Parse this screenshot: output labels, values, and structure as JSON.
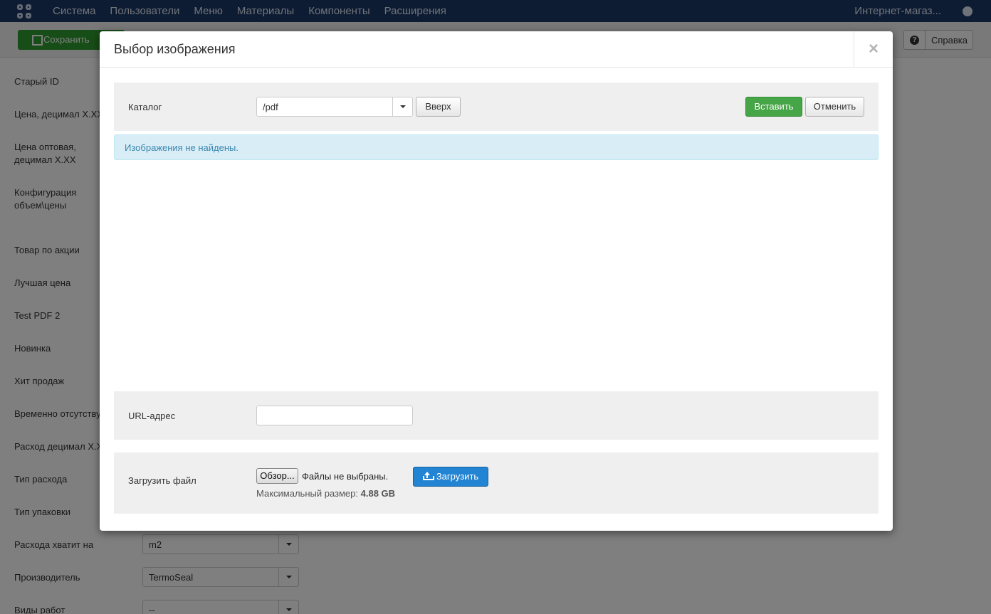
{
  "topbar": {
    "menu": [
      "Система",
      "Пользователи",
      "Меню",
      "Материалы",
      "Компоненты",
      "Расширения"
    ],
    "site_link": "Интернет-магаз..."
  },
  "toolbar": {
    "save_label": "Сохранить",
    "help_label": "Справка"
  },
  "form": {
    "labels": [
      "Старый ID",
      "Цена, децимал X.XX",
      "Цена оптовая, децимал X.XX",
      "Конфигурация объем\\цены",
      "Товар по акции",
      "Лучшая цена",
      "Test PDF 2",
      "Новинка",
      "Хит продаж",
      "Временно отсутствует",
      "Расход децимал X.XX",
      "Тип расхода",
      "Тип упаковки",
      "Расхода хватит на",
      "Производитель",
      "Виды работ"
    ],
    "selects": {
      "enough_for": "m2",
      "manufacturer": "TermoSeal",
      "work_types": "--"
    }
  },
  "modal": {
    "title": "Выбор изображения",
    "close_symbol": "×",
    "folder_label": "Каталог",
    "folder_value": "/pdf",
    "up_label": "Вверх",
    "insert_label": "Вставить",
    "cancel_label": "Отменить",
    "empty_message": "Изображения не найдены.",
    "url_label": "URL-адрес",
    "url_value": "",
    "upload_label": "Загрузить файл",
    "browse_label": "Обзор...",
    "no_files_label": "Файлы не выбраны.",
    "max_size_label": "Максимальный размер:",
    "max_size_value": "4.88 GB",
    "upload_button": "Загрузить"
  },
  "colors": {
    "insert_green": "#46a546",
    "upload_blue": "#2384d3",
    "alert_bg": "#d9edf7",
    "alert_text": "#3a87ad"
  }
}
